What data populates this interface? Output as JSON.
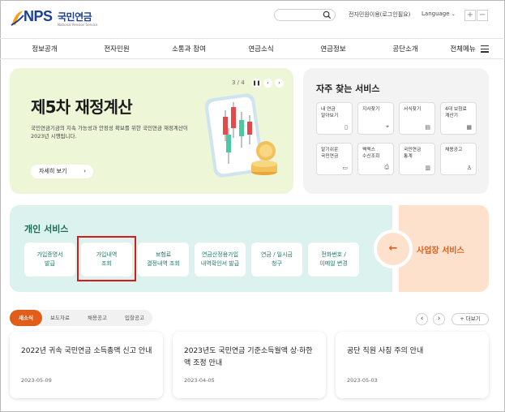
{
  "header": {
    "logo_text": "NPS",
    "logo_korean": "국민연금",
    "logo_sub": "National Pension Service",
    "search_placeholder": "",
    "util_link": "전자민원이용(로그인필요)",
    "language": "Language",
    "zoom_in": "+",
    "zoom_out": "−"
  },
  "nav": {
    "items": [
      "정보공개",
      "전자민원",
      "소통과 참여",
      "연금소식",
      "연금정보",
      "공단소개",
      "전체메뉴"
    ]
  },
  "hero": {
    "title": "제5차 재정계산",
    "description": "국민연금기금의 지속 가능성과 안정성 확보를 위한 국민연금 재정계산이 2023년 시행됩니다.",
    "button": "자세히 보기",
    "page_indicator": "3 / 4"
  },
  "frequent": {
    "title": "자주 찾는 서비스",
    "items": [
      {
        "label": "내 연금\n알아보기",
        "icon": "phone-document-icon"
      },
      {
        "label": "지사찾기",
        "icon": "map-pin-icon"
      },
      {
        "label": "서식찾기",
        "icon": "clipboard-icon"
      },
      {
        "label": "4대 보험료\n계산기",
        "icon": "calculator-icon"
      },
      {
        "label": "알기쉬운\n국민연금",
        "icon": "book-icon"
      },
      {
        "label": "팩맥스\n수신조회",
        "icon": "printer-icon"
      },
      {
        "label": "국민연금\n통계",
        "icon": "bar-chart-icon"
      },
      {
        "label": "채용공고",
        "icon": "person-edit-icon"
      }
    ]
  },
  "personal": {
    "title": "개인 서비스",
    "items": [
      "가입증명서\n발급",
      "가입내역\n조회",
      "보험료\n결정내역 조회",
      "연금산정용가입\n내역확인서 발급",
      "연금 / 일시금\n청구",
      "전화번호 /\n이메일 변경"
    ]
  },
  "business": {
    "label": "사업장 서비스",
    "arrow": "←"
  },
  "news": {
    "tabs": [
      "새소식",
      "보도자료",
      "채용공고",
      "입찰공고"
    ],
    "prev": "‹",
    "next": "›",
    "more": "+ 더보기",
    "items": [
      {
        "title": "2022년 귀속 국민연금 소득총액 신고 안내",
        "date": "2023-05-09"
      },
      {
        "title": "2023년도 국민연금 기준소득월액 상·하한액 조정 안내",
        "date": "2023-04-05"
      },
      {
        "title": "공단 직원 사칭 주의 안내",
        "date": "2023-05-03"
      }
    ]
  },
  "colors": {
    "brand_blue": "#1b3f94",
    "accent_orange": "#e05e19",
    "personal_green": "#1a7a64",
    "highlight_red": "#d81a1a"
  }
}
